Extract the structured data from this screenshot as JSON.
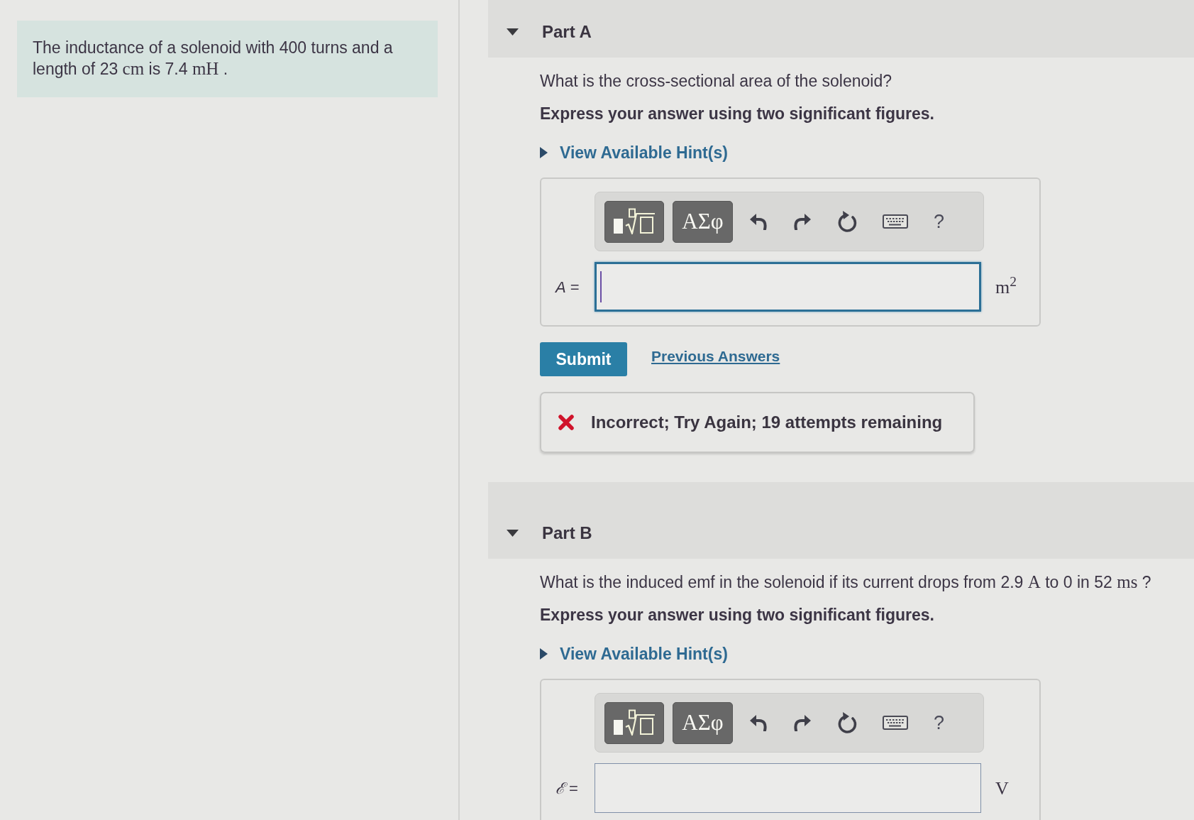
{
  "problem": {
    "segments": [
      {
        "kind": "text",
        "text": "The inductance of a solenoid with 400 turns and a length of 23 "
      },
      {
        "kind": "math",
        "text": "cm"
      },
      {
        "kind": "text",
        "text": " is 7.4 "
      },
      {
        "kind": "math",
        "text": "mH"
      },
      {
        "kind": "text",
        "text": " ."
      }
    ]
  },
  "parts": [
    {
      "title": "Part A",
      "expanded": true,
      "question": [
        {
          "kind": "text",
          "text": "What is the cross-sectional area of the solenoid?"
        }
      ],
      "instruction": "Express your answer using two significant figures.",
      "hint": {
        "label": "View Available Hint(s)",
        "expanded": false
      },
      "answer": {
        "toolbar": [
          {
            "kind": "templates"
          },
          {
            "kind": "symbols",
            "text": "ΑΣφ"
          },
          {
            "kind": "undo"
          },
          {
            "kind": "redo"
          },
          {
            "kind": "reset"
          },
          {
            "kind": "keyboard"
          },
          {
            "kind": "help",
            "text": "?"
          }
        ],
        "label": "*A* =",
        "focused": true,
        "unit": "m$^{2}$"
      },
      "submit": "Submit",
      "previous_answers": "Previous Answers",
      "feedback": {
        "kind": "incorrect",
        "text": "Incorrect; Try Again; 19 attempts remaining"
      }
    },
    {
      "title": "Part B",
      "expanded": true,
      "question": [
        {
          "kind": "text",
          "text": "What is the induced emf in the solenoid if its current drops from 2.9 "
        },
        {
          "kind": "math",
          "text": "A"
        },
        {
          "kind": "text",
          "text": " to 0 in 52 "
        },
        {
          "kind": "math",
          "text": "ms"
        },
        {
          "kind": "text",
          "text": " ?"
        }
      ],
      "instruction": "Express your answer using two significant figures.",
      "hint": {
        "label": "View Available Hint(s)",
        "expanded": false
      },
      "answer": {
        "toolbar": [
          {
            "kind": "templates"
          },
          {
            "kind": "symbols",
            "text": "ΑΣφ"
          },
          {
            "kind": "undo"
          },
          {
            "kind": "redo"
          },
          {
            "kind": "reset"
          },
          {
            "kind": "keyboard"
          },
          {
            "kind": "help",
            "text": "?"
          }
        ],
        "label": "*ℰ* =",
        "focused": false,
        "unit": "V"
      }
    }
  ]
}
